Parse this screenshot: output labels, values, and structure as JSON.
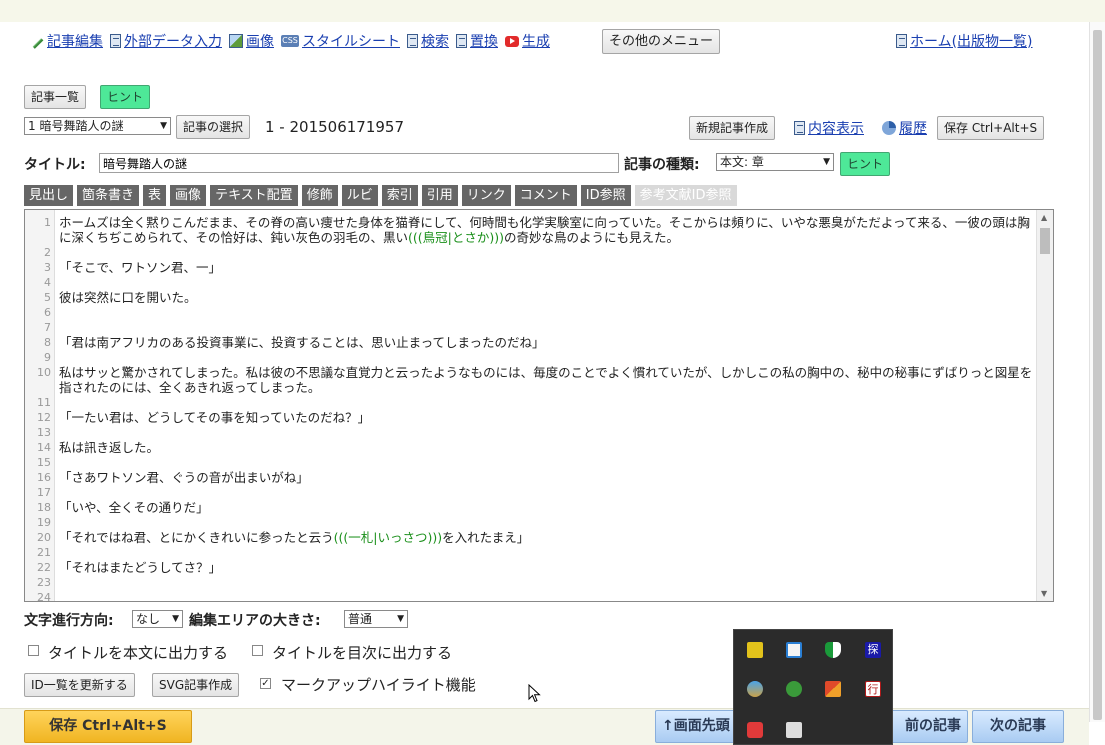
{
  "topnav": {
    "items": [
      {
        "label": "記事編集",
        "icon": "pencil-icon"
      },
      {
        "label": "外部データ入力",
        "icon": "document-icon"
      },
      {
        "label": "画像",
        "icon": "image-icon"
      },
      {
        "label": "スタイルシート",
        "icon": "css-icon"
      },
      {
        "label": "検索",
        "icon": "document-icon"
      },
      {
        "label": "置換",
        "icon": "document-icon"
      },
      {
        "label": "生成",
        "icon": "youtube-icon"
      }
    ],
    "other_menu": "その他のメニュー",
    "home": "ホーム(出版物一覧)"
  },
  "article": {
    "list_button": "記事一覧",
    "hint_button": "ヒント",
    "selected_article": "1 暗号舞踏人の謎",
    "select_button": "記事の選択",
    "article_id": "1 - 201506171957",
    "new_button": "新規記事作成",
    "view_link": "内容表示",
    "history_link": "履歴",
    "save_button": "保存 Ctrl+Alt+S"
  },
  "title": {
    "label": "タイトル:",
    "value": "暗号舞踏人の謎",
    "kind_label": "記事の種類:",
    "kind_value": "本文: 章",
    "hint_button": "ヒント"
  },
  "toolbar": {
    "items": [
      "見出し",
      "箇条書き",
      "表",
      "画像",
      "テキスト配置",
      "修飾",
      "ルビ",
      "索引",
      "引用",
      "リンク",
      "コメント",
      "ID参照"
    ],
    "disabled_item": "参考文献ID参照"
  },
  "editor": {
    "lines": [
      {
        "n": "1",
        "t": "ホームズは全く黙りこんだまま、その脊の高い痩せた身体を猫脊にして、何時間も化学実験室に向っていた。そこからは頻りに、いやな悪臭がただよって来る、一彼の頭は胸に深くちぢこめられて、その恰好は、鈍い灰色の羽毛の、黒い",
        "r": "(((鳥冠|とさか)))",
        "t2": "の奇妙な鳥のようにも見えた。"
      },
      {
        "n": "2",
        "t": ""
      },
      {
        "n": "3",
        "t": "「そこで、ワトソン君、一」"
      },
      {
        "n": "4",
        "t": ""
      },
      {
        "n": "5",
        "t": "彼は突然に口を開いた。"
      },
      {
        "n": "6",
        "t": ""
      },
      {
        "n": "7",
        "t": ""
      },
      {
        "n": "8",
        "t": "「君は南アフリカのある投資事業に、投資することは、思い止まってしまったのだね」"
      },
      {
        "n": "9",
        "t": ""
      },
      {
        "n": "10",
        "t": "私はサッと驚かされてしまった。私は彼の不思議な直覚力と云ったようなものには、毎度のことでよく慣れていたが、しかしこの私の胸中の、秘中の秘事にずばりっと図星を指されたのには、全くあきれ返ってしまった。"
      },
      {
        "n": "11",
        "t": ""
      },
      {
        "n": "12",
        "t": "「一たい君は、どうしてその事を知っていたのだね？」"
      },
      {
        "n": "13",
        "t": ""
      },
      {
        "n": "14",
        "t": "私は訊き返した。"
      },
      {
        "n": "15",
        "t": ""
      },
      {
        "n": "16",
        "t": "「さあワトソン君、ぐうの音が出まいがね」"
      },
      {
        "n": "17",
        "t": ""
      },
      {
        "n": "18",
        "t": "「いや、全くその通りだ」"
      },
      {
        "n": "19",
        "t": ""
      },
      {
        "n": "20",
        "t": "「それではね君、とにかくきれいに参ったと云う",
        "r": "(((一札|いっさつ)))",
        "t2": "を入れたまえ」"
      },
      {
        "n": "21",
        "t": ""
      },
      {
        "n": "22",
        "t": "「それはまたどうしてさ？」"
      },
      {
        "n": "23",
        "t": ""
      },
      {
        "n": "24",
        "t": ""
      }
    ]
  },
  "options": {
    "direction_label": "文字進行方向:",
    "direction_value": "なし",
    "size_label": "編集エリアの大きさ:",
    "size_value": "普通",
    "title_in_body": "タイトルを本文に出力する",
    "title_in_toc": "タイトルを目次に出力する",
    "update_ids": "ID一覧を更新する",
    "svg_article": "SVG記事作成",
    "highlight": "マークアップハイライト機能"
  },
  "bottom": {
    "save": "保存 Ctrl+Alt+S",
    "to_top": "↑画面先頭",
    "prev": "前の記事",
    "next": "次の記事"
  },
  "colors": {
    "green_button": "#4ee898",
    "save_orange": "#f0b522",
    "link_blue": "#1a3fb0",
    "ruby_green": "#1a8f1a"
  }
}
